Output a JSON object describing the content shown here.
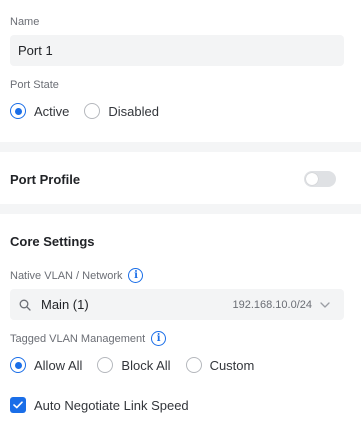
{
  "basic": {
    "name_label": "Name",
    "name_value": "Port 1",
    "port_state_label": "Port State",
    "port_state_options": [
      {
        "label": "Active",
        "checked": true
      },
      {
        "label": "Disabled",
        "checked": false
      }
    ]
  },
  "port_profile": {
    "title": "Port Profile",
    "enabled": false
  },
  "core": {
    "title": "Core Settings",
    "native_vlan_label": "Native VLAN / Network",
    "native_vlan_value": "Main (1)",
    "native_vlan_subnet": "192.168.10.0/24",
    "tagged_label": "Tagged VLAN Management",
    "tagged_options": [
      {
        "label": "Allow All",
        "checked": true
      },
      {
        "label": "Block All",
        "checked": false
      },
      {
        "label": "Custom",
        "checked": false
      }
    ],
    "auto_negotiate_label": "Auto Negotiate Link Speed",
    "auto_negotiate_checked": true
  },
  "icons": {
    "info": "info-icon",
    "search": "search-icon",
    "chevron": "chevron-down-icon",
    "check": "check-icon"
  },
  "colors": {
    "accent": "#1a6ee8",
    "page_bg": "#f4f5f6",
    "input_bg": "#f3f4f5"
  }
}
